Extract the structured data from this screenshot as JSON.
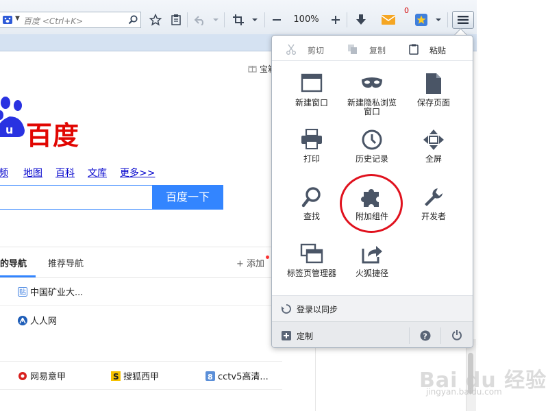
{
  "toolbar": {
    "search_placeholder": "百度 <Ctrl+K>",
    "zoom": "100%",
    "mail_count": "0"
  },
  "page": {
    "gift_label": "宝箱",
    "logo_text": "百度",
    "nav_links": [
      "频",
      "地图",
      "百科",
      "文库",
      "更多>>"
    ],
    "search_button": "百度一下",
    "tabs": {
      "my_nav": "的导航",
      "recommend": "推荐导航",
      "add": "添加"
    },
    "items": {
      "mining": "中国矿业大...",
      "renren": "人人网",
      "wangyi": "网易意甲",
      "sohu": "搜狐西甲",
      "cctv": "cctv5高清..."
    }
  },
  "menu": {
    "cut": "剪切",
    "copy": "复制",
    "paste": "粘贴",
    "new_window": "新建窗口",
    "private_line1": "新建隐私浏览",
    "private_line2": "窗口",
    "save_page": "保存页面",
    "print": "打印",
    "history": "历史记录",
    "fullscreen": "全屏",
    "find": "查找",
    "addons": "附加组件",
    "developer": "开发者",
    "tab_groups": "标签页管理器",
    "shortcut": "火狐捷径",
    "sync": "登录以同步",
    "customize": "定制"
  },
  "watermark": {
    "text": "Bai du 经验",
    "url": "jingyan.baidu.com"
  },
  "colors": {
    "accent": "#3385ff",
    "logo_red": "#e10602",
    "annotation": "#e0121e",
    "link": "#0000cc"
  }
}
